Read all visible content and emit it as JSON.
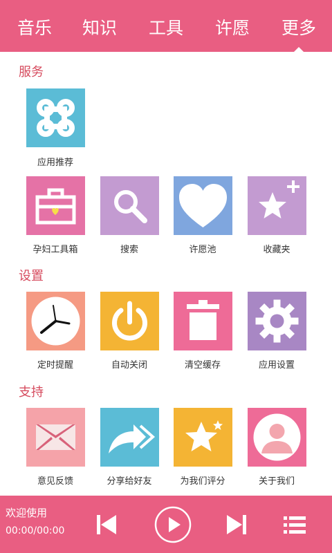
{
  "tabs": [
    {
      "label": "音乐"
    },
    {
      "label": "知识"
    },
    {
      "label": "工具"
    },
    {
      "label": "许愿"
    },
    {
      "label": "更多"
    }
  ],
  "active_tab": "更多",
  "sections": {
    "services": {
      "title": "服务",
      "items": [
        {
          "label": "应用推荐",
          "icon": "command-icon",
          "color": "#5bbcd6"
        },
        {
          "label": "孕妇工具箱",
          "icon": "toolbox-icon",
          "color": "#e572a6"
        },
        {
          "label": "搜索",
          "icon": "search-icon",
          "color": "#c39bd1"
        },
        {
          "label": "许愿池",
          "icon": "heart-icon",
          "color": "#7fa6de"
        },
        {
          "label": "收藏夹",
          "icon": "star-plus-icon",
          "color": "#c39bd1"
        }
      ]
    },
    "settings": {
      "title": "设置",
      "items": [
        {
          "label": "定时提醒",
          "icon": "clock-icon",
          "color": "#f59a83"
        },
        {
          "label": "自动关闭",
          "icon": "power-icon",
          "color": "#f4b434"
        },
        {
          "label": "清空缓存",
          "icon": "trash-icon",
          "color": "#ee6b97"
        },
        {
          "label": "应用设置",
          "icon": "gear-icon",
          "color": "#a887c4"
        }
      ]
    },
    "support": {
      "title": "支持",
      "items": [
        {
          "label": "意见反馈",
          "icon": "mail-icon",
          "color": "#f5a3a9"
        },
        {
          "label": "分享给好友",
          "icon": "share-icon",
          "color": "#5bbcd6"
        },
        {
          "label": "为我们评分",
          "icon": "rate-star-icon",
          "color": "#f4b434"
        },
        {
          "label": "关于我们",
          "icon": "user-icon",
          "color": "#ee6b97"
        }
      ]
    }
  },
  "player": {
    "title": "欢迎使用",
    "time": "00:00/00:00",
    "controls": [
      "previous-icon",
      "play-icon",
      "next-icon",
      "playlist-icon"
    ]
  },
  "colors": {
    "brand": "#e95e82",
    "section_title": "#d64b5e"
  }
}
